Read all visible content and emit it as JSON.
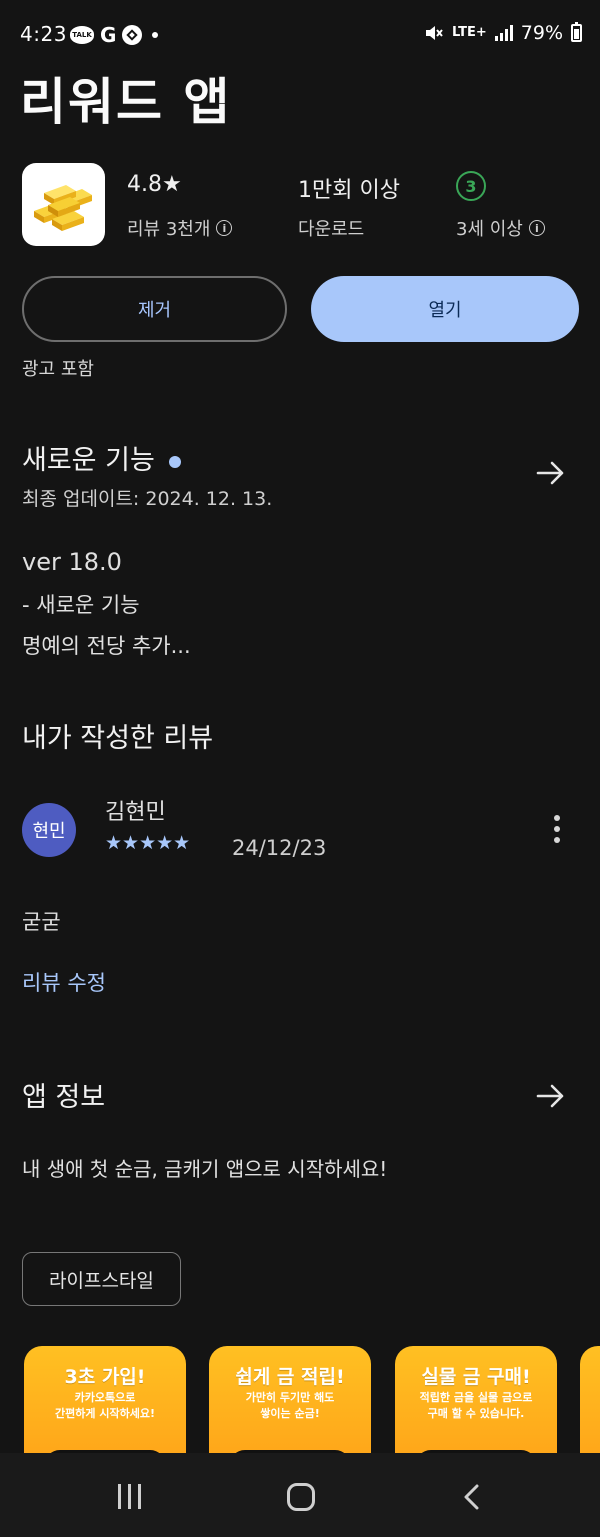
{
  "status": {
    "time": "4:23",
    "talk_label": "TALK",
    "g_label": "G",
    "network": "LTE+",
    "battery": "79%"
  },
  "app": {
    "title": "리워드 앱",
    "rating": "4.8★",
    "reviews": "리뷰 3천개",
    "downloads": "1만회 이상",
    "downloads_label": "다운로드",
    "age_badge": "3",
    "age_label": "3세 이상"
  },
  "actions": {
    "uninstall": "제거",
    "open": "열기",
    "ads_note": "광고 포함"
  },
  "whats_new": {
    "title": "새로운 기능",
    "updated": "최종 업데이트: 2024. 12. 13.",
    "version": "ver 18.0",
    "line1": "- 새로운 기능",
    "line2": "명예의 전당 추가..."
  },
  "my_review": {
    "title": "내가 작성한 리뷰",
    "avatar": "현민",
    "name": "김현민",
    "stars": "★★★★★",
    "date": "24/12/23",
    "text": "굳굳",
    "edit": "리뷰 수정"
  },
  "about": {
    "title": "앱 정보",
    "description": "내 생애 첫 순금, 금캐기 앱으로 시작하세요!",
    "category": "라이프스타일"
  },
  "screenshots": [
    {
      "title": "3초 가입!",
      "sub": "카카오톡으로\n간편하게 시작하세요!"
    },
    {
      "title": "쉽게 금 적립!",
      "sub": "가만히 두기만 해도\n쌓이는 순금!"
    },
    {
      "title": "실물 금 구매!",
      "sub": "적립한 금을 실물 금으로\n구매 할 수 있습니다."
    }
  ],
  "colors": {
    "background": "#141414",
    "accent": "#a8c7fa",
    "age_green": "#3aa657",
    "avatar": "#4e5cc1",
    "promo_orange": "#ffa91c"
  }
}
